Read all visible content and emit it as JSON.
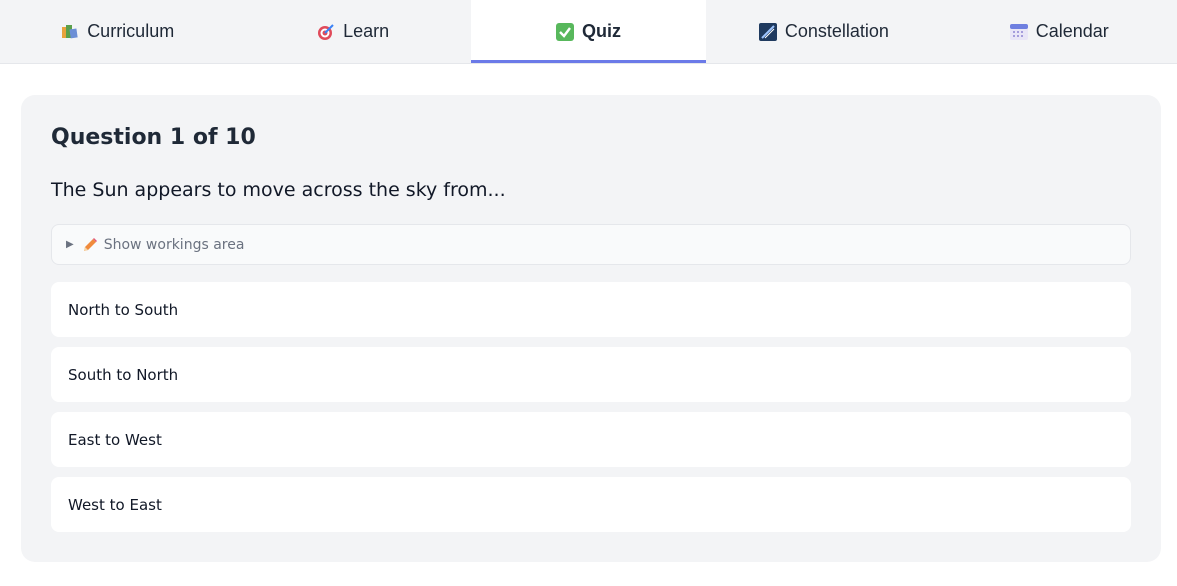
{
  "tabs": [
    {
      "label": "Curriculum",
      "icon": "books-icon"
    },
    {
      "label": "Learn",
      "icon": "target-icon"
    },
    {
      "label": "Quiz",
      "icon": "checkmark-icon",
      "active": true
    },
    {
      "label": "Constellation",
      "icon": "constellation-icon"
    },
    {
      "label": "Calendar",
      "icon": "calendar-icon"
    }
  ],
  "quiz": {
    "title": "Question 1 of 10",
    "question": "The Sun appears to move across the sky from...",
    "workings_label": "Show workings area",
    "options": [
      "North to South",
      "South to North",
      "East to West",
      "West to East"
    ]
  },
  "colors": {
    "accent": "#6b7ae8",
    "card_bg": "#f3f4f6"
  }
}
